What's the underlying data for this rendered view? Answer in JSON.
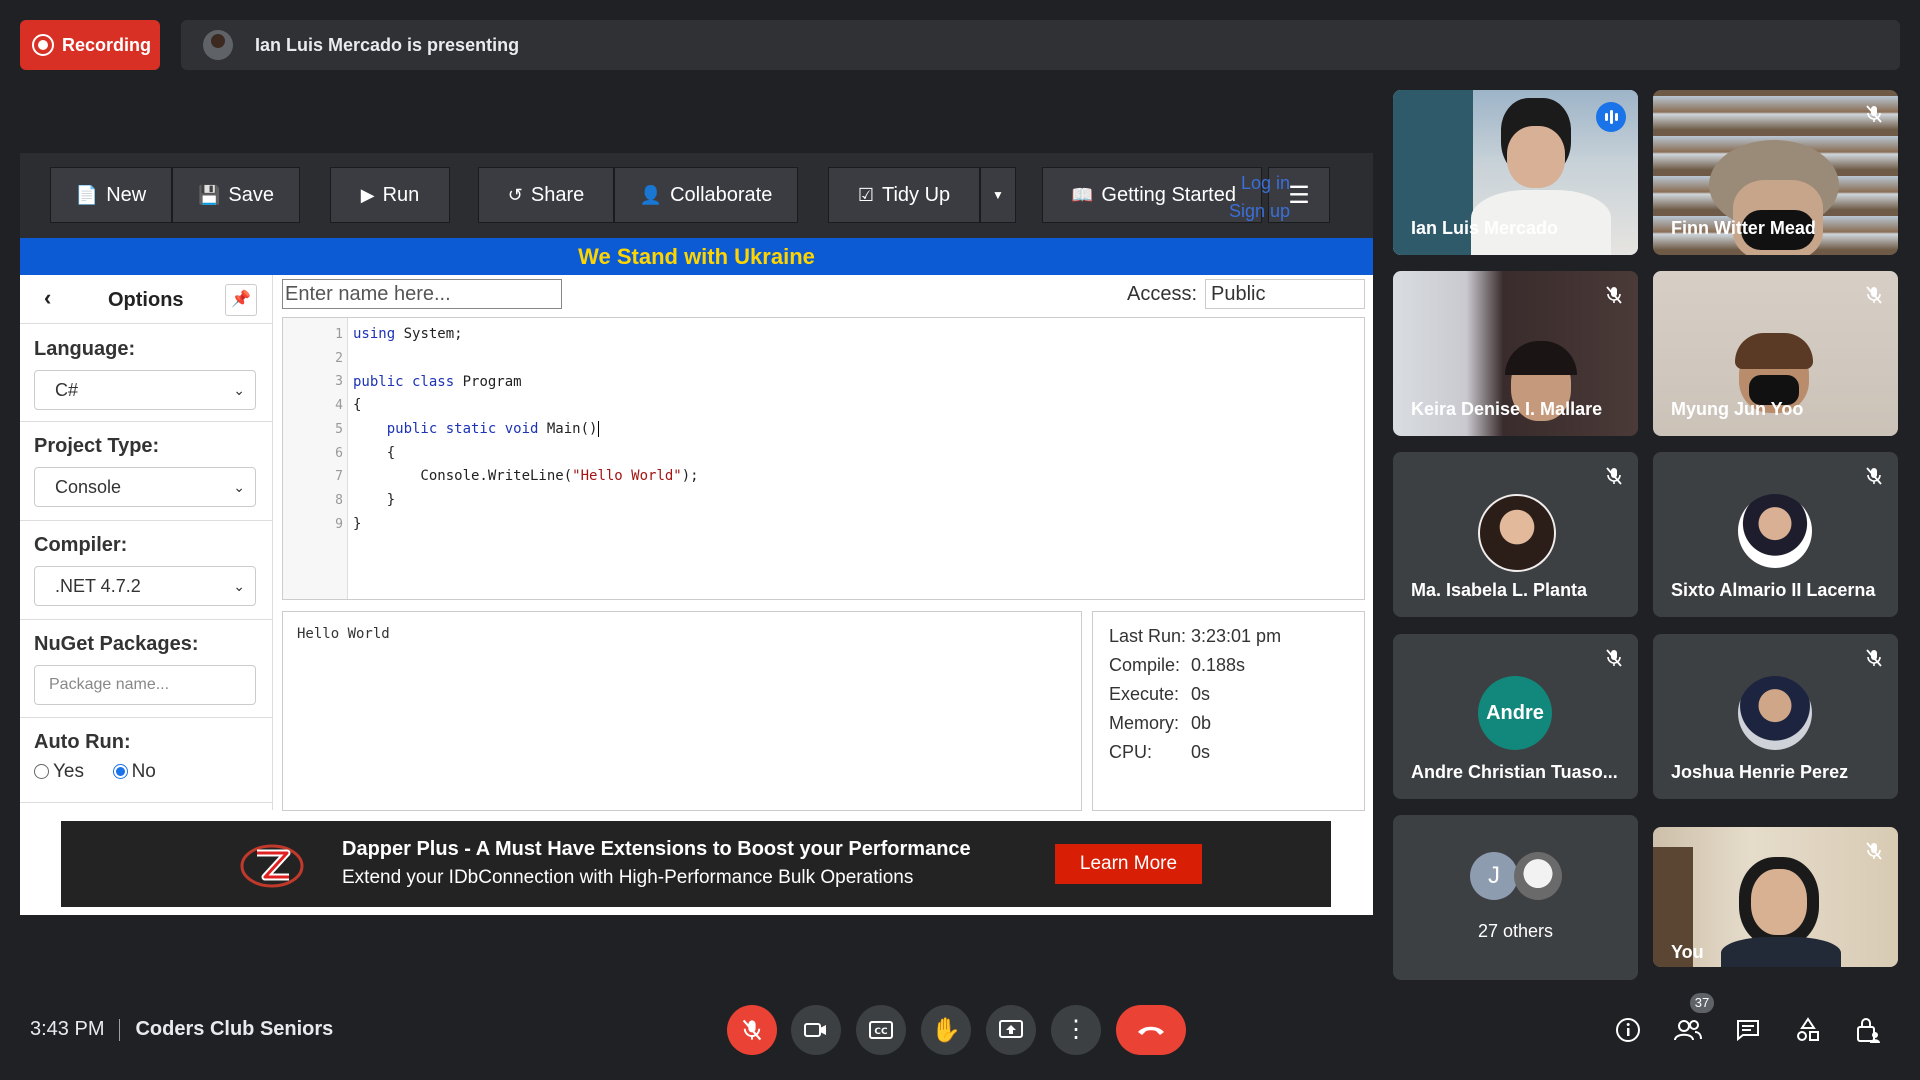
{
  "meeting": {
    "recording_label": "Recording",
    "presenting_text": "Ian Luis Mercado is presenting",
    "time": "3:43 PM",
    "title": "Coders Club Seniors",
    "participant_count": "37"
  },
  "app": {
    "toolbar": {
      "new": "New",
      "save": "Save",
      "run": "Run",
      "share": "Share",
      "collaborate": "Collaborate",
      "tidy_up": "Tidy Up",
      "getting_started": "Getting Started",
      "log_in": "Log in",
      "sign_up": "Sign up"
    },
    "banner": "We Stand with Ukraine",
    "options": {
      "title": "Options",
      "language_label": "Language:",
      "language_value": "C#",
      "project_type_label": "Project Type:",
      "project_type_value": "Console",
      "compiler_label": "Compiler:",
      "compiler_value": ".NET 4.7.2",
      "nuget_label": "NuGet Packages:",
      "nuget_placeholder": "Package name...",
      "autorun_label": "Auto Run:",
      "autorun_yes": "Yes",
      "autorun_no": "No"
    },
    "name_placeholder": "Enter name here...",
    "access_label": "Access:",
    "access_value": "Public",
    "line_numbers": [
      "1",
      "2",
      "3",
      "4",
      "5",
      "6",
      "7",
      "8",
      "9"
    ],
    "code": {
      "l1_kw": "using",
      "l1_rest": " System;",
      "l3_kw": "public class",
      "l3_rest": " Program",
      "l4": "{",
      "l5_indent": "    ",
      "l5_kw": "public static void",
      "l5_rest": " Main()",
      "l6": "    {",
      "l7_pre": "        Console.WriteLine(",
      "l7_str": "\"Hello World\"",
      "l7_post": ");",
      "l8": "    }",
      "l9": "}"
    },
    "output": "Hello World",
    "stats": {
      "last_run_label": "Last Run:",
      "last_run_value": "3:23:01 pm",
      "compile_label": "Compile:",
      "compile_value": "0.188s",
      "execute_label": "Execute:",
      "execute_value": "0s",
      "memory_label": "Memory:",
      "memory_value": "0b",
      "cpu_label": "CPU:",
      "cpu_value": "0s"
    },
    "ad": {
      "headline": "Dapper Plus - A Must Have Extensions to Boost your Performance",
      "subline": "Extend your IDbConnection with High-Performance Bulk Operations",
      "cta": "Learn More"
    }
  },
  "participants": {
    "p1": "Ian Luis Mercado",
    "p2": "Finn Witter Mead",
    "p3": "Keira Denise I. Mallare",
    "p4": "Myung Jun Yoo",
    "p5": "Ma. Isabela L. Planta",
    "p6": "Sixto Almario II Lacerna",
    "p7": "Andre Christian Tuaso...",
    "p7_avatar": "Andre",
    "p8": "Joshua Henrie Perez",
    "others_avatar": "J",
    "others": "27 others",
    "you": "You"
  },
  "colors": {
    "recording_red": "#d93025",
    "ukraine_blue": "#0c5bd4",
    "ukraine_yellow": "#ffd500",
    "andre_avatar": "#12877b",
    "j_avatar": "#8e9cb0",
    "speaking_blue": "#1a73e8"
  }
}
